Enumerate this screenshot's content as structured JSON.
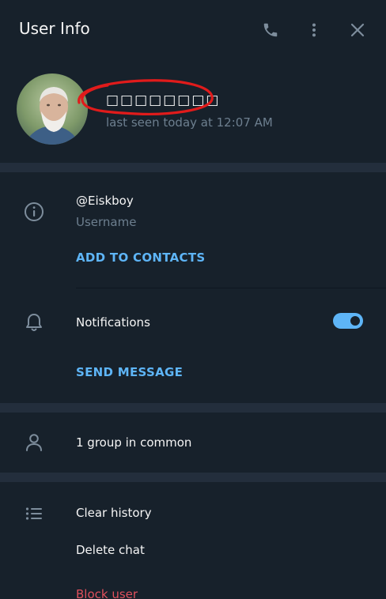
{
  "header": {
    "title": "User Info",
    "icons": {
      "call": "phone-icon",
      "more": "more-vertical-icon",
      "close": "close-icon"
    }
  },
  "profile": {
    "name": "□□□□□□□□",
    "status": "last seen today at 12:07 AM",
    "avatar": "avatar-photo"
  },
  "info": {
    "username": "@Eiskboy",
    "username_label": "Username",
    "add_to_contacts": "ADD TO CONTACTS",
    "notifications_label": "Notifications",
    "notifications_on": true,
    "send_message": "SEND MESSAGE"
  },
  "groups": {
    "label": "1 group in common"
  },
  "actions": {
    "clear_history": "Clear history",
    "delete_chat": "Delete chat",
    "block_user": "Block user"
  },
  "colors": {
    "background": "#17212b",
    "divider": "#232e3c",
    "accent": "#5eb5f7",
    "muted": "#6d7f8f",
    "danger": "#e0505c",
    "annotation": "#e01b1b"
  }
}
